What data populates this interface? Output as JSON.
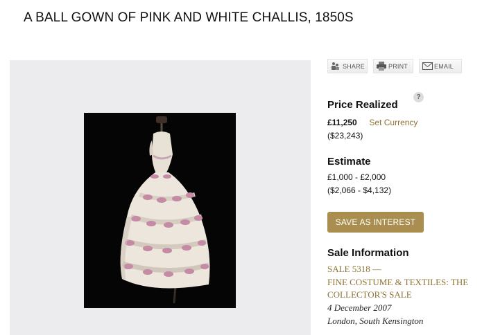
{
  "lot": {
    "title": "A BALL GOWN OF PINK AND WHITE CHALLIS, 1850S"
  },
  "share_tools": {
    "share": "SHARE",
    "print": "PRINT",
    "email": "EMAIL"
  },
  "price": {
    "heading": "Price Realized",
    "amount": "£11,250",
    "set_currency": "Set Currency",
    "converted": "($23,243)",
    "help": "?"
  },
  "estimate": {
    "heading": "Estimate",
    "range": "£1,000 - £2,000",
    "converted": "($2,066 - $4,132)"
  },
  "actions": {
    "save_interest": "SAVE AS INTEREST"
  },
  "sale": {
    "heading": "Sale Information",
    "number": "SALE 5318 —",
    "name_line1": "FINE COSTUME & TEXTILES: THE",
    "name_line2": "COLLECTOR'S SALE",
    "date": "4 December 2007",
    "location": "London, South Kensington"
  },
  "colors": {
    "accent_gold": "#a98e4f",
    "link_gold": "#8c7335",
    "image_panel_bg": "#ececee"
  },
  "icons": [
    "share-icon",
    "print-icon",
    "email-icon",
    "help-icon"
  ]
}
